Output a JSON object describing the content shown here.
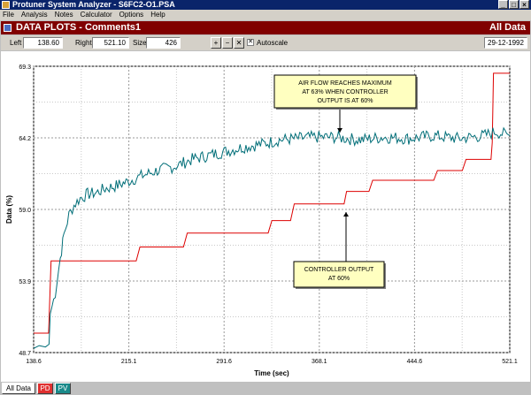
{
  "window": {
    "title": "Protuner System Analyzer - S6FC2-O1.PSA",
    "minimize": "_",
    "maximize": "□",
    "close": "×"
  },
  "menu": [
    "File",
    "Analysis",
    "Notes",
    "Calculator",
    "Options",
    "Help"
  ],
  "header": {
    "title": "DATA PLOTS - Comments1",
    "right_label": "All Data"
  },
  "toolbar": {
    "left_label": "Left",
    "left_value": "138.60",
    "right_label": "Right",
    "right_value": "521.10",
    "size_label": "Size",
    "size_value": "426",
    "zoom_in": "+",
    "zoom_out": "−",
    "zoom_reset": "✕",
    "autoscale_checked": "✕",
    "autoscale_label": "Autoscale",
    "date": "29-12-1992"
  },
  "chart_data": {
    "type": "line",
    "xlabel": "Time (sec)",
    "ylabel": "Data (%)",
    "xlim": [
      138.6,
      521.1
    ],
    "ylim": [
      48.7,
      69.3
    ],
    "x_ticks": [
      "138.6",
      "215.1",
      "291.6",
      "368.1",
      "444.6",
      "521.1"
    ],
    "y_ticks": [
      "69.3",
      "64.2",
      "59.0",
      "53.9",
      "48.7"
    ],
    "grid": true,
    "series": [
      {
        "name": "PD",
        "color": "#dd0000",
        "points": [
          [
            138.6,
            50.1
          ],
          [
            150.6,
            50.1
          ],
          [
            152.6,
            55.3
          ],
          [
            221.0,
            55.3
          ],
          [
            224.0,
            56.3
          ],
          [
            259.0,
            56.3
          ],
          [
            262.0,
            57.3
          ],
          [
            327.0,
            57.3
          ],
          [
            330.0,
            58.2
          ],
          [
            345.0,
            58.2
          ],
          [
            348.0,
            59.4
          ],
          [
            388.0,
            59.4
          ],
          [
            390.0,
            60.3
          ],
          [
            408.0,
            60.3
          ],
          [
            411.0,
            61.1
          ],
          [
            460.0,
            61.1
          ],
          [
            463.0,
            61.8
          ],
          [
            483.0,
            61.8
          ],
          [
            486.0,
            62.6
          ],
          [
            506.0,
            62.6
          ],
          [
            507.0,
            63.8
          ],
          [
            508.0,
            68.8
          ],
          [
            521.1,
            68.8
          ]
        ]
      },
      {
        "name": "PV",
        "color": "#006e78",
        "points": [
          [
            138.6,
            49.0
          ],
          [
            143.0,
            49.2
          ],
          [
            148.0,
            49.1
          ],
          [
            151.0,
            49.3
          ],
          [
            152.0,
            51.5
          ],
          [
            156.0,
            53.0
          ],
          [
            160.0,
            55.5
          ],
          [
            163.0,
            57.2
          ],
          [
            167.0,
            58.6
          ],
          [
            171.0,
            59.3
          ],
          [
            176.0,
            59.8
          ],
          [
            182.0,
            60.1
          ],
          [
            189.0,
            60.2
          ],
          [
            196.0,
            60.5
          ],
          [
            205.0,
            60.7
          ],
          [
            214.0,
            61.0
          ],
          [
            225.0,
            61.4
          ],
          [
            238.0,
            61.8
          ],
          [
            252.0,
            62.1
          ],
          [
            266.0,
            62.6
          ],
          [
            280.0,
            62.9
          ],
          [
            294.0,
            63.2
          ],
          [
            308.0,
            63.5
          ],
          [
            322.0,
            63.7
          ],
          [
            336.0,
            64.0
          ],
          [
            350.0,
            64.1
          ],
          [
            364.0,
            64.2
          ],
          [
            380.0,
            64.2
          ],
          [
            400.0,
            64.0
          ],
          [
            420.0,
            64.2
          ],
          [
            440.0,
            64.1
          ],
          [
            460.0,
            64.3
          ],
          [
            480.0,
            64.1
          ],
          [
            500.0,
            64.3
          ],
          [
            510.0,
            64.6
          ],
          [
            521.1,
            64.3
          ]
        ]
      }
    ],
    "annotations": [
      {
        "text": [
          "AIR FLOW REACHES MAXIMUM",
          "AT 63% WHEN CONTROLLER",
          "OUTPUT IS AT 60%"
        ]
      },
      {
        "text": [
          "CONTROLLER OUTPUT",
          "AT 60%"
        ]
      }
    ]
  },
  "bottom_tabs": [
    {
      "label": "All Data",
      "bg": "#ffffff",
      "fg": "#000000"
    },
    {
      "label": "PD",
      "bg": "#e03030",
      "fg": "#ffffff"
    },
    {
      "label": "PV",
      "bg": "#1a8a8a",
      "fg": "#ffffff"
    }
  ]
}
